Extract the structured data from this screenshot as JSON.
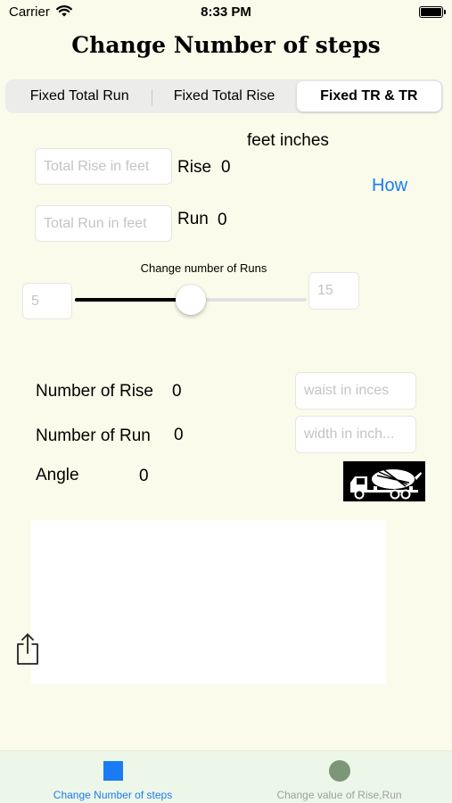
{
  "status_bar": {
    "carrier": "Carrier",
    "time": "8:33 PM",
    "wifi_icon": "wifi-icon",
    "battery_icon": "battery-icon"
  },
  "title": "Change Number of steps",
  "segments": {
    "items": [
      "Fixed Total Run",
      "Fixed Total Rise",
      "Fixed TR & TR"
    ],
    "selected_index": 2
  },
  "units_label": "feet inches",
  "how_link": "How",
  "rise_input": {
    "placeholder": "Total Rise in feet",
    "value": ""
  },
  "rise": {
    "label": "Rise",
    "value": "0"
  },
  "run_input": {
    "placeholder": "Total Run in feet",
    "value": ""
  },
  "run": {
    "label": "Run",
    "value": "0"
  },
  "slider": {
    "label": "Change number of Runs",
    "min_placeholder": "5",
    "max_placeholder": "15",
    "position_fraction": 0.5
  },
  "number_of_rise": {
    "label": "Number of Rise",
    "value": "0"
  },
  "number_of_run": {
    "label": "Number of Run",
    "value": "0"
  },
  "angle": {
    "label": "Angle",
    "value": "0"
  },
  "waist_input": {
    "placeholder": "waist in inces"
  },
  "width_input": {
    "placeholder": "width in inch..."
  },
  "truck_image": "concrete-mixer-truck-icon",
  "share_icon": "share-icon",
  "tabbar": {
    "tabs": [
      {
        "label": "Change Number of steps",
        "icon": "square-icon",
        "selected": true,
        "color": "#1a7cf5"
      },
      {
        "label": "Change value of Rise,Run",
        "icon": "circle-icon",
        "selected": false,
        "color": "#9aa39a"
      }
    ]
  },
  "colors": {
    "background": "#fbfbeb",
    "accent": "#1a7cf5",
    "tabbar_background": "#edf7e9"
  }
}
